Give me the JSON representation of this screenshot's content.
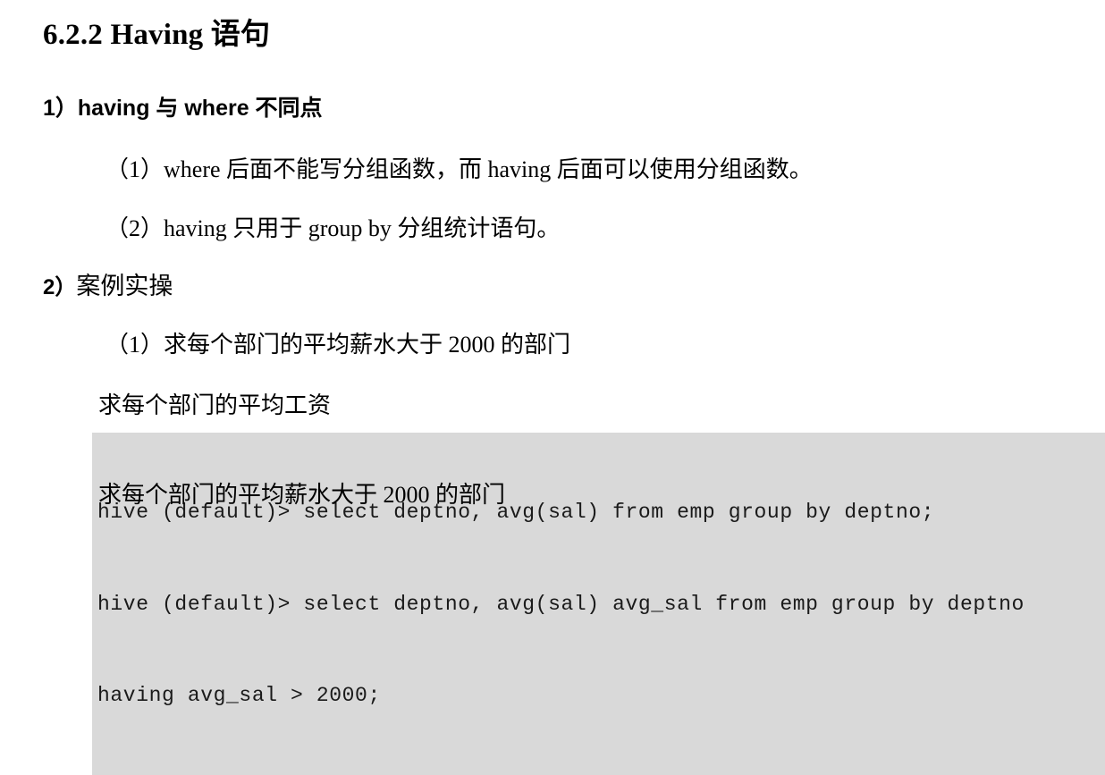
{
  "document": {
    "title": "6.2.2 Having 语句",
    "sections": [
      {
        "heading": "1）having 与 where 不同点",
        "items": [
          "（1）where 后面不能写分组函数，而 having 后面可以使用分组函数。",
          "（2）having 只用于 group by 分组统计语句。"
        ]
      },
      {
        "heading_num": "2）",
        "heading_text": "案例实操",
        "items": [
          "（1）求每个部门的平均薪水大于 2000 的部门"
        ],
        "examples": [
          {
            "caption": "求每个部门的平均工资",
            "code": "hive (default)> select deptno, avg(sal) from emp group by deptno;"
          },
          {
            "caption": "求每个部门的平均薪水大于 2000 的部门",
            "code_line_1": "hive (default)> select deptno, avg(sal) avg_sal from emp group by deptno",
            "code_line_2": "having avg_sal > 2000;"
          }
        ]
      }
    ]
  },
  "colors": {
    "page_background": "#ffffff",
    "code_background": "#d9d9d9",
    "text": "#000000"
  }
}
